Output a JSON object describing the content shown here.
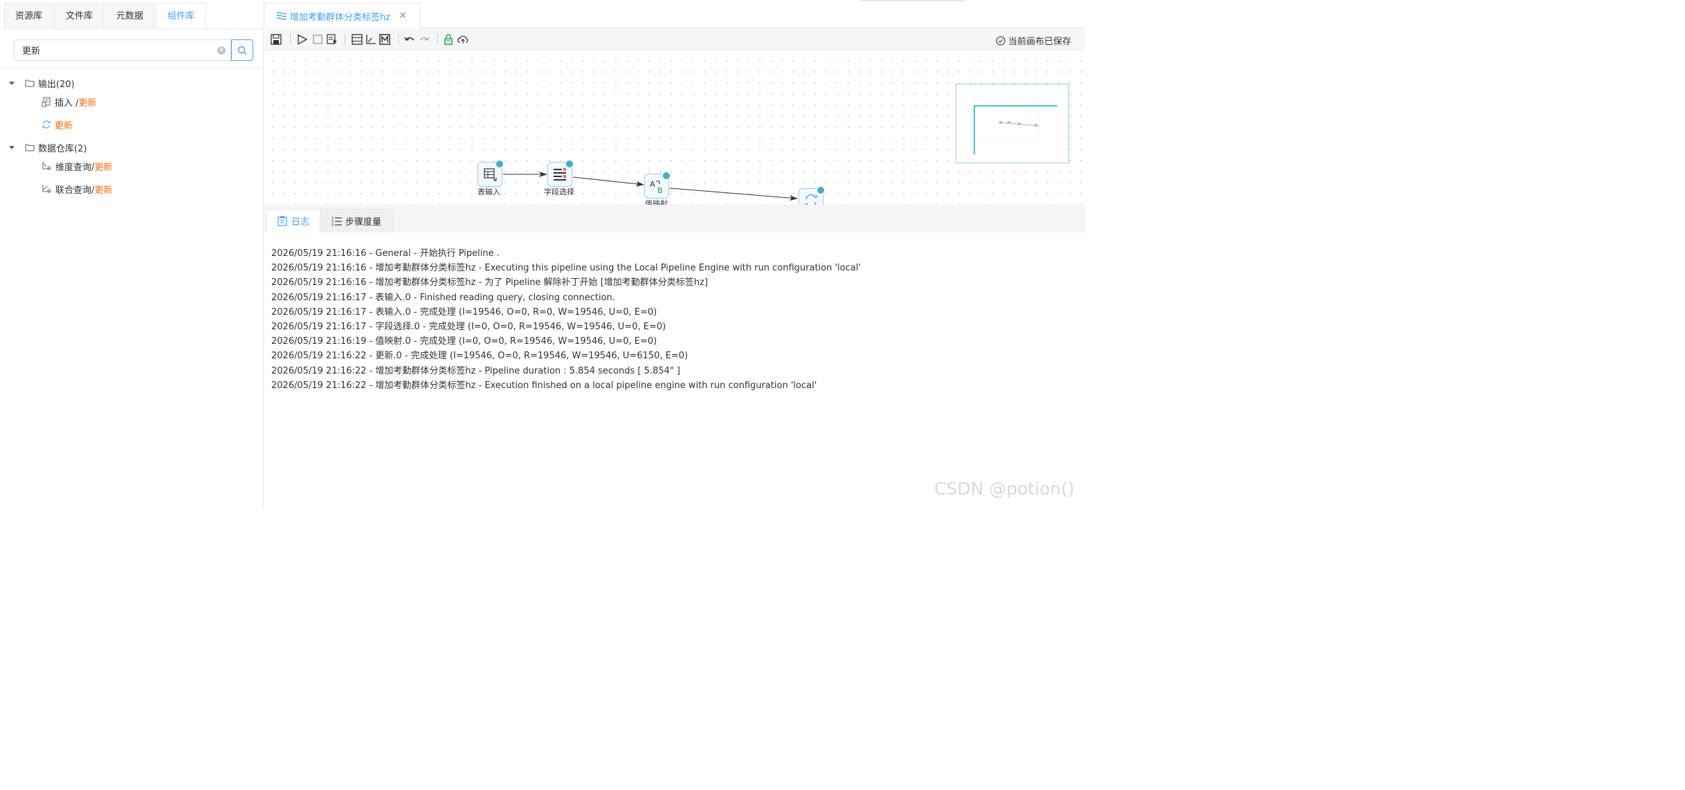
{
  "left_panel": {
    "tabs": [
      {
        "label": "资源库"
      },
      {
        "label": "文件库"
      },
      {
        "label": "元数据"
      },
      {
        "label": "组件库"
      }
    ],
    "active_tab": "组件库",
    "search": {
      "value": "更新"
    },
    "tree": {
      "group1": {
        "label": "输出(20)"
      },
      "group1_item1": {
        "prefix": "插入 / ",
        "highlight": "更新"
      },
      "group1_item2": {
        "highlight": "更新"
      },
      "group2": {
        "label": "数据仓库(2)"
      },
      "group2_item1": {
        "prefix": "维度查询/ ",
        "highlight": "更新"
      },
      "group2_item2": {
        "prefix": "联合查询/ ",
        "highlight": "更新"
      }
    }
  },
  "editor": {
    "tab_title": "增加考勤群体分类标签hz",
    "save_status": "当前画布已保存",
    "nodes": {
      "n1": "表输入",
      "n2": "字段选择",
      "n3": "值映射"
    }
  },
  "bottom": {
    "tabs": [
      {
        "label": "日志"
      },
      {
        "label": "步骤度量"
      }
    ],
    "logs": [
      "2026/05/19 21:16:16 - General - 开始执行 Pipeline .",
      "2026/05/19 21:16:16 - 增加考勤群体分类标签hz - Executing this pipeline using the Local Pipeline Engine with run configuration 'local'",
      "2026/05/19 21:16:16 - 增加考勤群体分类标签hz - 为了 Pipeline 解除补丁开始 [增加考勤群体分类标签hz]",
      "2026/05/19 21:16:17 - 表输入.0 - Finished reading query, closing connection.",
      "2026/05/19 21:16:17 - 表输入.0 - 完成处理 (I=19546, O=0, R=0, W=19546, U=0, E=0)",
      "2026/05/19 21:16:17 - 字段选择.0 - 完成处理 (I=0, O=0, R=19546, W=19546, U=0, E=0)",
      "2026/05/19 21:16:19 - 值映射.0 - 完成处理 (I=0, O=0, R=19546, W=19546, U=0, E=0)",
      "2026/05/19 21:16:22 - 更新.0 - 完成处理 (I=19546, O=0, R=19546, W=19546, U=6150, E=0)",
      "2026/05/19 21:16:22 - 增加考勤群体分类标签hz - Pipeline duration : 5.854 seconds [  5.854\" ]",
      "2026/05/19 21:16:22 - 增加考勤群体分类标签hz - Execution finished on a local pipeline engine with run configuration 'local'"
    ]
  },
  "watermark": "CSDN @potion()",
  "colors": {
    "accent": "#409eff",
    "highlight": "#ff6a00",
    "check": "#3bb0c9"
  }
}
